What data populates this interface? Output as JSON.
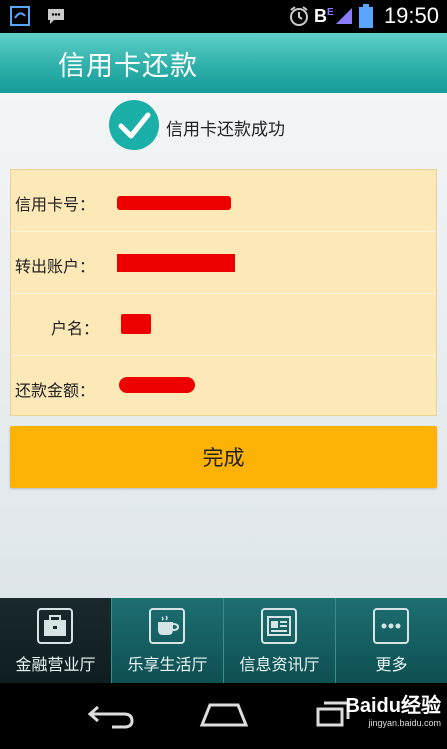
{
  "status_bar": {
    "time": "19:50",
    "network_letter": "B",
    "network_sub": "E"
  },
  "title_bar": {
    "title": "信用卡还款"
  },
  "success": {
    "message": "信用卡还款成功"
  },
  "info": {
    "rows": [
      {
        "label": "信用卡号：",
        "value_redacted": true
      },
      {
        "label": "转出账户：",
        "value_redacted": true
      },
      {
        "label": "户名：",
        "value_redacted": true
      },
      {
        "label": "还款金额：",
        "value_redacted": true
      }
    ]
  },
  "done_button": {
    "label": "完成"
  },
  "tabs": [
    {
      "label": "金融营业厅",
      "icon": "briefcase-icon",
      "active": true
    },
    {
      "label": "乐享生活厅",
      "icon": "coffee-cup-icon",
      "active": false
    },
    {
      "label": "信息资讯厅",
      "icon": "newspaper-icon",
      "active": false
    },
    {
      "label": "更多",
      "icon": "more-dots-icon",
      "active": false
    }
  ],
  "watermark": {
    "brand": "Baidu经验",
    "url": "jingyan.baidu.com"
  },
  "colors": {
    "title_bar": "#2fb0aa",
    "check_circle": "#1ab0a8",
    "info_bg": "#fde9b8",
    "done_button": "#fdb206",
    "redaction": "#ee0000"
  }
}
